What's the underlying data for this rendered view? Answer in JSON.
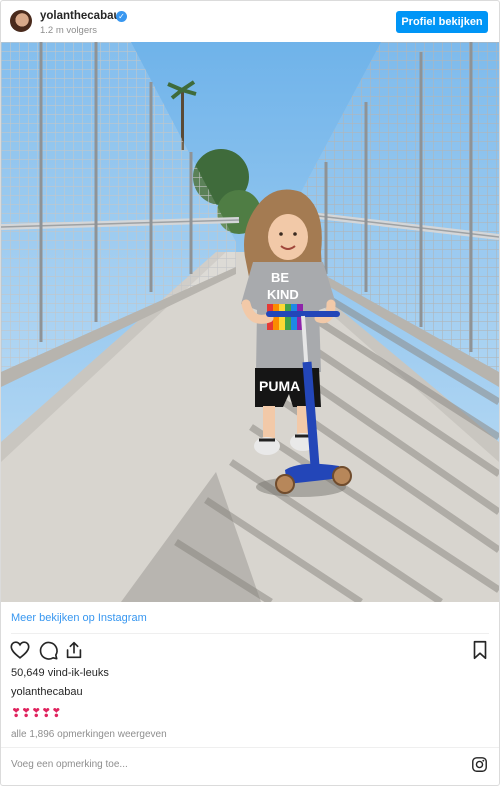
{
  "header": {
    "username": "yolanthecabau",
    "followers": "1.2 m volgers",
    "profile_button": "Profiel bekijken"
  },
  "post": {
    "more_link": "Meer bekijken op Instagram",
    "likes": "50,649 vind-ik-leuks",
    "caption_user": "yolanthecabau",
    "caption_text": "❣❣❣❣❣",
    "comments_link": "alle 1,896 opmerkingen weergeven",
    "comment_placeholder": "Voeg een opmerking toe..."
  },
  "photo": {
    "shirt_text_top": "BE",
    "shirt_text_bottom": "KIND",
    "shorts_text": "PUMA"
  },
  "colors": {
    "accent": "#0095f6",
    "link": "#3897f0",
    "text": "#262626",
    "muted": "#8e8e8e"
  }
}
